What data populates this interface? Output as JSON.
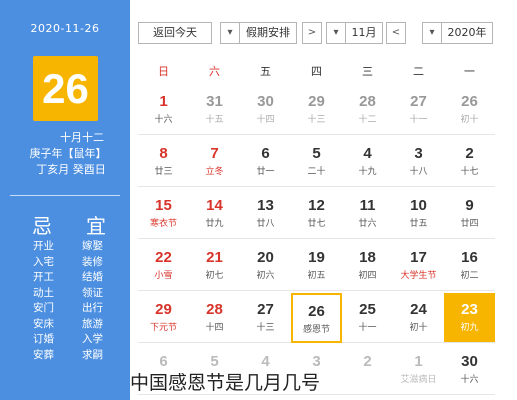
{
  "left": {
    "date": "2020-11-26",
    "day": "26",
    "lunar": [
      "十月十二",
      "庚子年【鼠年】",
      "丁亥月 癸酉日"
    ],
    "ji_label": "忌",
    "yi_label": "宜",
    "ji": [
      "开业",
      "入宅",
      "开工",
      "动土",
      "安门",
      "安床",
      "订婚",
      "安葬"
    ],
    "yi": [
      "嫁娶",
      "装修",
      "结婚",
      "领证",
      "出行",
      "旅游",
      "入学",
      "求嗣"
    ]
  },
  "toolbar": {
    "return_today": "返回今天",
    "holiday": "假期安排",
    "month": "11月",
    "year": "2020年",
    "dropdown_icon": "▾",
    "prev_icon": "<",
    "next_icon": ">"
  },
  "weekdays": [
    "日",
    "六",
    "五",
    "四",
    "三",
    "二",
    "一"
  ],
  "rows": [
    [
      {
        "d": "1",
        "l": "十六"
      },
      {
        "d": "31",
        "l": "十五"
      },
      {
        "d": "30",
        "l": "十四"
      },
      {
        "d": "29",
        "l": "十三"
      },
      {
        "d": "28",
        "l": "十二"
      },
      {
        "d": "27",
        "l": "十一"
      },
      {
        "d": "26",
        "l": "初十"
      }
    ],
    [
      {
        "d": "8",
        "l": "廿三"
      },
      {
        "d": "7",
        "l": "立冬"
      },
      {
        "d": "6",
        "l": "廿一"
      },
      {
        "d": "5",
        "l": "二十"
      },
      {
        "d": "4",
        "l": "十九"
      },
      {
        "d": "3",
        "l": "十八"
      },
      {
        "d": "2",
        "l": "十七"
      }
    ],
    [
      {
        "d": "15",
        "l": "寒衣节"
      },
      {
        "d": "14",
        "l": "廿九"
      },
      {
        "d": "13",
        "l": "廿八"
      },
      {
        "d": "12",
        "l": "廿七"
      },
      {
        "d": "11",
        "l": "廿六"
      },
      {
        "d": "10",
        "l": "廿五"
      },
      {
        "d": "9",
        "l": "廿四"
      }
    ],
    [
      {
        "d": "22",
        "l": "小雪"
      },
      {
        "d": "21",
        "l": "初七"
      },
      {
        "d": "20",
        "l": "初六"
      },
      {
        "d": "19",
        "l": "初五"
      },
      {
        "d": "18",
        "l": "初四"
      },
      {
        "d": "17",
        "l": "大学生节"
      },
      {
        "d": "16",
        "l": "初二"
      }
    ],
    [
      {
        "d": "29",
        "l": "下元节"
      },
      {
        "d": "28",
        "l": "十四"
      },
      {
        "d": "27",
        "l": "十三"
      },
      {
        "d": "26",
        "l": "感恩节"
      },
      {
        "d": "25",
        "l": "十一"
      },
      {
        "d": "24",
        "l": "初十"
      },
      {
        "d": "23",
        "l": "初九"
      }
    ],
    [
      {
        "d": "6",
        "l": ""
      },
      {
        "d": "5",
        "l": ""
      },
      {
        "d": "4",
        "l": ""
      },
      {
        "d": "3",
        "l": ""
      },
      {
        "d": "2",
        "l": ""
      },
      {
        "d": "1",
        "l": "艾滋病日"
      },
      {
        "d": "30",
        "l": "十六"
      }
    ]
  ],
  "caption": "中国感恩节是几月几号",
  "colors": {
    "panel_blue": "#4c8fe0",
    "highlight_yellow": "#f7b500",
    "weekend_red": "#d9342b"
  }
}
